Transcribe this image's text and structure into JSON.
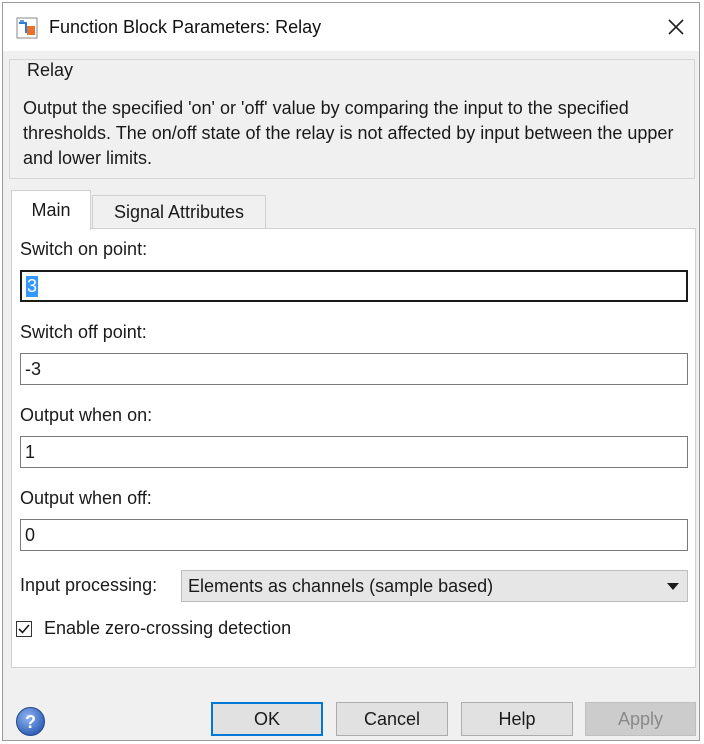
{
  "window": {
    "title": "Function Block Parameters: Relay",
    "close_icon": "close-icon",
    "app_icon": "simulink-block-icon"
  },
  "description": {
    "heading": "Relay",
    "text": "Output the specified 'on' or 'off' value by comparing the input to the specified thresholds.  The on/off state of the relay is not affected by input between the upper and lower limits."
  },
  "tabs": [
    {
      "label": "Main",
      "active": true
    },
    {
      "label": "Signal Attributes",
      "active": false
    }
  ],
  "fields": {
    "switch_on": {
      "label": "Switch on point:",
      "value": "3"
    },
    "switch_off": {
      "label": "Switch off point:",
      "value": "-3"
    },
    "output_on": {
      "label": "Output when on:",
      "value": "1"
    },
    "output_off": {
      "label": "Output when off:",
      "value": "0"
    }
  },
  "input_processing": {
    "label": "Input processing:",
    "selected": "Elements as channels (sample based)"
  },
  "zero_crossing": {
    "label": "Enable zero-crossing detection",
    "checked": true
  },
  "buttons": {
    "ok": "OK",
    "cancel": "Cancel",
    "help": "Help",
    "apply": "Apply"
  },
  "colors": {
    "selection": "#3399ff",
    "default_button_border": "#0078d7",
    "help_icon": "#3b6fc4"
  }
}
